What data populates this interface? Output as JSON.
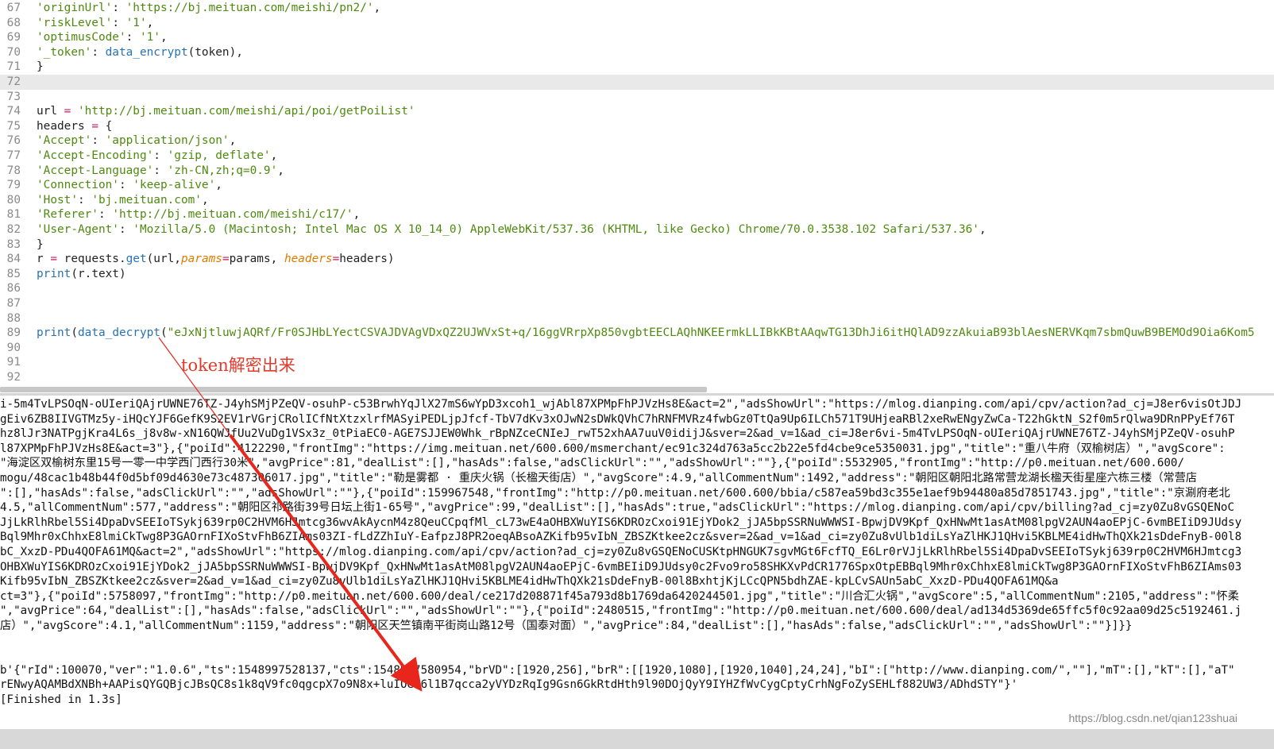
{
  "editor": {
    "lines": [
      {
        "n": "67",
        "code": "'originUrl': 'https://bj.meituan.com/meishi/pn2/',"
      },
      {
        "n": "68",
        "code": "'riskLevel': '1',"
      },
      {
        "n": "69",
        "code": "'optimusCode': '1',"
      },
      {
        "n": "70",
        "code": "'_token': data_encrypt(token),"
      },
      {
        "n": "71",
        "code": "}"
      },
      {
        "n": "72",
        "code": ""
      },
      {
        "n": "73",
        "code": ""
      },
      {
        "n": "74",
        "code": "url = 'http://bj.meituan.com/meishi/api/poi/getPoiList'"
      },
      {
        "n": "75",
        "code": "headers = {"
      },
      {
        "n": "76",
        "code": "'Accept': 'application/json',"
      },
      {
        "n": "77",
        "code": "'Accept-Encoding': 'gzip, deflate',"
      },
      {
        "n": "78",
        "code": "'Accept-Language': 'zh-CN,zh;q=0.9',"
      },
      {
        "n": "79",
        "code": "'Connection': 'keep-alive',"
      },
      {
        "n": "80",
        "code": "'Host': 'bj.meituan.com',"
      },
      {
        "n": "81",
        "code": "'Referer': 'http://bj.meituan.com/meishi/c17/',"
      },
      {
        "n": "82",
        "code": "'User-Agent': 'Mozilla/5.0 (Macintosh; Intel Mac OS X 10_14_0) AppleWebKit/537.36 (KHTML, like Gecko) Chrome/70.0.3538.102 Safari/537.36',"
      },
      {
        "n": "83",
        "code": "}"
      },
      {
        "n": "84",
        "code": "r = requests.get(url,params=params, headers=headers)"
      },
      {
        "n": "85",
        "code": "print(r.text)"
      },
      {
        "n": "86",
        "code": ""
      },
      {
        "n": "87",
        "code": ""
      },
      {
        "n": "88",
        "code": ""
      },
      {
        "n": "89",
        "code": "print(data_decrypt(\"eJxNjtluwjAQRf/Fr0SJHbLYectCSVAJDVAgVDxQZ2UJWVxSt+q/16ggVRrpXp850vgbtEECLAQhNKEErmkLLIBkKBtAAqwTG13DhJi6itHQlAD9zzAkuiaB93blAesNERVKqm7sbmQuwB9BEMOd9Oia6Kom5"
      },
      {
        "n": "90",
        "code": ""
      },
      {
        "n": "91",
        "code": ""
      },
      {
        "n": "92",
        "code": ""
      }
    ],
    "current_line": "72"
  },
  "annotation": {
    "text": "token解密出来"
  },
  "output": {
    "lines": [
      "i-5m4TvLPSOqN-oUIeriQAjrUWNE76TZ-J4yhSMjPZeQV-osuhP-c53BrwhYqJlX27mS6wYpD3xcoh1_wjAbl87XPMpFhPJVzHs8E&act=2\",\"adsShowUrl\":\"https://mlog.dianping.com/api/cpv/action?ad_cj=J8er6visOtJDJ",
      "gEiv6ZB8IIVGTMz5y-iHQcYJF6GefK9S2EV1rVGrjCRolICfNtXtzxlrfMASyiPEDLjpJfcf-TbV7dKv3xOJwN2sDWkQVhC7hRNFMVRz4fwbGz0TtQa9Up6ILCh571T9UHjeaRBl2xeRwENgyZwCa-T22hGktN_S2f0m5rQlwa9DRnPPyEf76T",
      "hz8lJr3NATPgjKra4L6s_j8v8w-xN16QWJfUu2VuDg1VSx3z_0tPiaEC0-AGE7SJJEW0Whk_rBpNZceCNIeJ_rwT52xhAA7uuV0idijJ&sver=2&ad_v=1&ad_ci=J8er6vi-5m4TvLPSOqN-oUIeriQAjrUWNE76TZ-J4yhSMjPZeQV-osuhP",
      "l87XPMpFhPJVzHs8E&act=3\"},{\"poiId\":4122290,\"frontImg\":\"https://img.meituan.net/600.600/msmerchant/ec91c324d763a5cc2b22e5fd4cbe9ce5350031.jpg\",\"title\":\"重八牛府（双榆树店）\",\"avgScore\":",
      "\"海淀区双榆树东里15号一零一中学西门西行30米\",\"avgPrice\":81,\"dealList\":[],\"hasAds\":false,\"adsClickUrl\":\"\",\"adsShowUrl\":\"\"},{\"poiId\":5532905,\"frontImg\":\"http://p0.meituan.net/600.600/",
      "mogu/48cac1b48b44f0d5bf09d4630e73c487306017.jpg\",\"title\":\"勒是雾都 · 重庆火锅（长楹天街店）\",\"avgScore\":4.9,\"allCommentNum\":1492,\"address\":\"朝阳区朝阳北路常营龙湖长楹天街星座六栋三楼（常营店",
      "\":[],\"hasAds\":false,\"adsClickUrl\":\"\",\"adsShowUrl\":\"\"},{\"poiId\":159967548,\"frontImg\":\"http://p0.meituan.net/600.600/bbia/c587ea59bd3c355e1aef9b94480a85d7851743.jpg\",\"title\":\"京涮府老北",
      "4.5,\"allCommentNum\":577,\"address\":\"朝阳区祁路街39号日坛上街1-65号\",\"avgPrice\":99,\"dealList\":[],\"hasAds\":true,\"adsClickUrl\":\"https://mlog.dianping.com/api/cpv/billing?ad_cj=zy0Zu8vGSQENoC",
      "JjLkRlhRbel5Si4DpaDvSEEIoTSykj639rp0C2HVM6HJmtcg36wvAkAycnM4z8QeuCCpqfMl_cL73wE4aOHBXWuYIS6KDROzCxoi91EjYDok2_jJA5bpSSRNuWWWSI-BpwjDV9Kpf_QxHNwMt1asAtM08lpgV2AUN4aoEPjC-6vmBEIiD9JUdsy",
      "Bql9Mhr0xChhxE8lmiCkTwg8P3GAOrnFIXoStvFhB6ZIAms03ZI-fLdZZhIuY-EafpzJ8PR2oeqABsoAZKifb95vIbN_ZBSZKtkee2cz&sver=2&ad_v=1&ad_ci=zy0Zu8vUlb1diLsYaZlHKJ1QHvi5KBLME4idHwThQXk21sDdeFnyB-00l8",
      "bC_XxzD-PDu4QOFA61MQ&act=2\",\"adsShowUrl\":\"https://mlog.dianping.com/api/cpv/action?ad_cj=zy0Zu8vGSQENoCUSKtpHNGUK7sgvMGt6FcfTQ_E6Lr0rVJjLkRlhRbel5Si4DpaDvSEEIoTSykj639rp0C2HVM6HJmtcg3",
      "OHBXWuYIS6KDROzCxoi91EjYDok2_jJA5bpSSRNuWWWSI-BpwjDV9Kpf_QxHNwMt1asAtM08lpgV2AUN4aoEPjC-6vmBEIiD9JUdsy0c2Fvo9ro58SHKXvPdCR1776SpxOtpEBBql9Mhr0xChhxE8lmiCkTwg8P3GAOrnFIXoStvFhB6ZIAms03",
      "Kifb95vIbN_ZBSZKtkee2cz&sver=2&ad_v=1&ad_ci=zy0Zu8vUlb1diLsYaZlHKJ1QHvi5KBLME4idHwThQXk21sDdeFnyB-00l8BxhtjKjLCcQPN5bdhZAE-kpLCvSAUn5abC_XxzD-PDu4QOFA61MQ&a",
      "ct=3\"},{\"poiId\":5758097,\"frontImg\":\"http://p0.meituan.net/600.600/deal/ce217d208871f45a793d8b1769da6420244501.jpg\",\"title\":\"川合汇火锅\",\"avgScore\":5,\"allCommentNum\":2105,\"address\":\"怀柔",
      "\",\"avgPrice\":64,\"dealList\":[],\"hasAds\":false,\"adsClickUrl\":\"\",\"adsShowUrl\":\"\"},{\"poiId\":2480515,\"frontImg\":\"http://p0.meituan.net/600.600/deal/ad134d5369de65ffc5f0c92aa09d25c5192461.j",
      "店）\",\"avgScore\":4.1,\"allCommentNum\":1159,\"address\":\"朝阳区天竺镇南平街岗山路12号（国泰对面）\",\"avgPrice\":84,\"dealList\":[],\"hasAds\":false,\"adsClickUrl\":\"\",\"adsShowUrl\":\"\"}]}}",
      "",
      "",
      "b'{\"rId\":100070,\"ver\":\"1.0.6\",\"ts\":1548997528137,\"cts\":1548997580954,\"brVD\":[1920,256],\"brR\":[[1920,1080],[1920,1040],24,24],\"bI\":[\"http://www.dianping.com/\",\"\"],\"mT\":[],\"kT\":[],\"aT\"",
      "rENwyAQAMBdXNBh+AAPisQYGQBjcJBsQC8s1k8qV9fc0qgcpX7o9N8x+luIOee6l1B7qcca2yVYDzRqIg9Gsn6GkRtdHth9l90DOjQyY9IYHZfWvCygCptyCrhNgFoZySEHLf882UW3/ADhdSTY\"}'",
      "[Finished in 1.3s]"
    ]
  },
  "watermark": "https://blog.csdn.net/qian123shuai",
  "colors": {
    "string": "#4e8a0f",
    "function": "#2773b5",
    "operator": "#c2185b",
    "parameter": "#e07a00",
    "annotation": "#e03a2a",
    "line_number": "#8a8a8a"
  }
}
